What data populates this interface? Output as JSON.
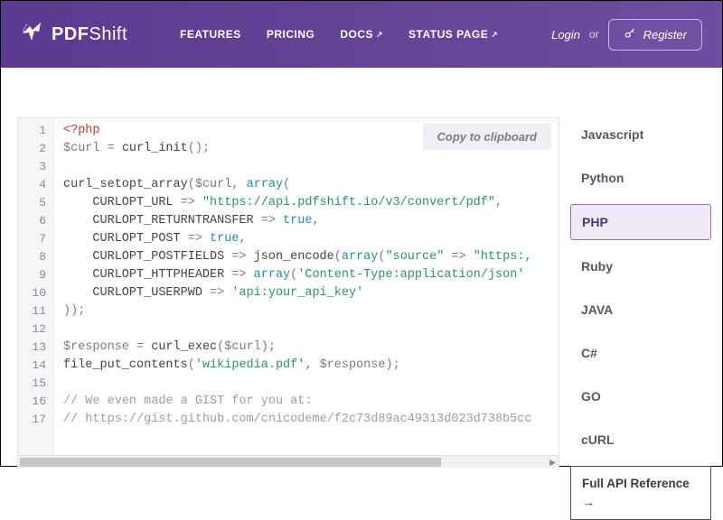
{
  "brand": {
    "prefix": "PDF",
    "suffix": "Shift"
  },
  "nav": {
    "features": "FEATURES",
    "pricing": "PRICING",
    "docs": "DOCS",
    "status": "STATUS PAGE"
  },
  "auth": {
    "login": "Login",
    "or": "or",
    "register": "Register"
  },
  "copy_label": "Copy to clipboard",
  "lines": [
    "1",
    "2",
    "3",
    "4",
    "5",
    "6",
    "7",
    "8",
    "9",
    "10",
    "11",
    "12",
    "13",
    "14",
    "15",
    "16",
    "17"
  ],
  "code": {
    "l1_tag": "<?php",
    "l2_var": "$curl",
    "l2_eq": " = ",
    "l2_fn": "curl_init",
    "l2_tail": "();",
    "l4_fn": "curl_setopt_array",
    "l4_open": "(",
    "l4_var": "$curl",
    "l4_comma": ", ",
    "l4_kw": "array",
    "l4_tail": "(",
    "l5_c": "CURLOPT_URL",
    "l5_arrow": " => ",
    "l5_s": "\"https://api.pdfshift.io/v3/convert/pdf\"",
    "l5_tail": ",",
    "l6_c": "CURLOPT_RETURNTRANSFER",
    "l6_arrow": " => ",
    "l6_kw": "true",
    "l6_tail": ",",
    "l7_c": "CURLOPT_POST",
    "l7_arrow": " => ",
    "l7_kw": "true",
    "l7_tail": ",",
    "l8_c": "CURLOPT_POSTFIELDS",
    "l8_arrow": " => ",
    "l8_fn": "json_encode",
    "l8_open": "(",
    "l8_kw": "array",
    "l8_open2": "(",
    "l8_s1": "\"source\"",
    "l8_arrow2": " => ",
    "l8_s2": "\"https:,",
    "l9_c": "CURLOPT_HTTPHEADER",
    "l9_arrow": " => ",
    "l9_kw": "array",
    "l9_open": "(",
    "l9_s": "'Content-Type:application/json'",
    "l10_c": "CURLOPT_USERPWD",
    "l10_arrow": " => ",
    "l10_s": "'api:your_api_key'",
    "l11": "));",
    "l13_var": "$response",
    "l13_eq": " = ",
    "l13_fn": "curl_exec",
    "l13_open": "(",
    "l13_var2": "$curl",
    "l13_tail": ");",
    "l14_fn": "file_put_contents",
    "l14_open": "(",
    "l14_s": "'wikipedia.pdf'",
    "l14_comma": ", ",
    "l14_var": "$response",
    "l14_tail": ");",
    "l16_comment": "// We even made a GIST for you at:",
    "l17_comment": "// https://gist.github.com/cnicodeme/f2c73d89ac49313d023d738b5cc"
  },
  "langs": {
    "js": "Javascript",
    "python": "Python",
    "php": "PHP",
    "ruby": "Ruby",
    "java": "JAVA",
    "csharp": "C#",
    "go": "GO",
    "curl": "cURL"
  },
  "api_ref": "Full API Reference"
}
